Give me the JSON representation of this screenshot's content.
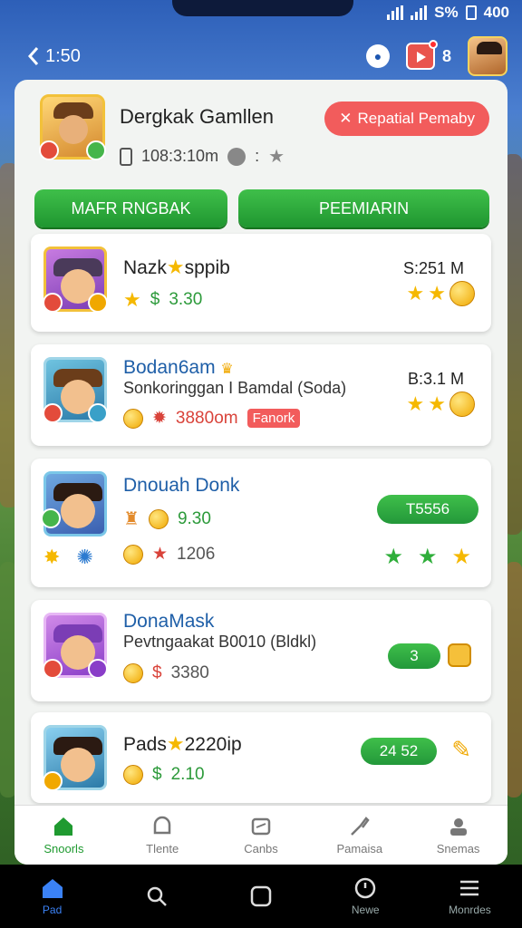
{
  "status": {
    "battery_text": "S%",
    "time": "400"
  },
  "header": {
    "back_label": "1:50",
    "notif_count": "8"
  },
  "profile": {
    "name": "Dergkak Gamllen",
    "meta": "108:3:10m",
    "meta_sep": ":",
    "report_label": "Repatial Pemaby"
  },
  "actions": {
    "left": "MAFR RNGBAK",
    "right": "PEEMIARIN"
  },
  "games": [
    {
      "title": "Nazk",
      "title_suffix": "sppib",
      "value": "3.30",
      "price": "S:251 M"
    },
    {
      "title": "Bodan6am",
      "subtitle": "Sonkoringgan I Bamdal (Soda)",
      "value": "3880om",
      "chip": "Fanork",
      "price": "B:3.1 M"
    },
    {
      "title": "Dnouah Donk",
      "value": "9.30",
      "value2": "1206",
      "pill": "T5556"
    },
    {
      "title": "DonaMask",
      "subtitle": "Pevtngaakat B0010 (Bldkl)",
      "value": "3380",
      "pill": "3"
    },
    {
      "title": "Pads",
      "title_suffix": "2220ip",
      "value": "2.10",
      "pill": "24 52"
    }
  ],
  "tabs": [
    "Snoorls",
    "Tlente",
    "Canbs",
    "Pamaisa",
    "Snemas"
  ],
  "sysnav": [
    "Pad",
    "",
    "",
    "Newe",
    "Monrdes"
  ],
  "colors": {
    "green": "#1f9a30",
    "red": "#f25c5c",
    "blue": "#1f5fa8",
    "gold": "#f5b800"
  }
}
